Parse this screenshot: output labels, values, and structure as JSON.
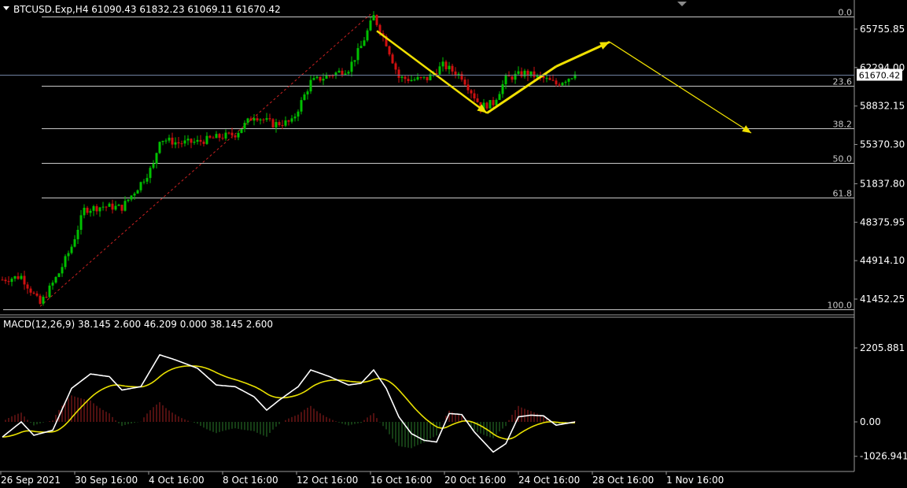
{
  "window": {
    "main_header": "BTCUSD.Exp,H4  61090.43 61832.23 61069.11 61670.42",
    "macd_header": "MACD(12,26,9) 38.145 2.600 46.209 0.000 38.145 2.600"
  },
  "colors": {
    "background": "#000000",
    "bull_candle": "#00c000",
    "bear_candle": "#d01010",
    "fib_line": "#c8c8c8",
    "price_line": "#7080a0",
    "trend_line": "#cc2222",
    "arrow": "#f0e000",
    "macd_line": "#ffffff",
    "signal_line": "#e8e000",
    "hist_pos": "#a02020",
    "hist_neg": "#2a7a2a"
  },
  "chart_data": [
    {
      "type": "candlestick",
      "symbol": "BTCUSD.Exp",
      "timeframe": "H4",
      "ohlc_header": {
        "open": 61090.43,
        "high": 61832.23,
        "low": 61069.11,
        "close": 61670.42
      },
      "y_ticks": [
        "65755.85",
        "62294.00",
        "58832.15",
        "55370.30",
        "51837.80",
        "48375.95",
        "44914.10",
        "41452.25"
      ],
      "ylim": [
        41452.25,
        65755.85
      ],
      "current_price": 61670.42,
      "current_price_label": "61670.42",
      "x_ticks": [
        "26 Sep 2021",
        "30 Sep 16:00",
        "4 Oct 16:00",
        "8 Oct 16:00",
        "12 Oct 16:00",
        "16 Oct 16:00",
        "20 Oct 16:00",
        "24 Oct 16:00",
        "28 Oct 16:00",
        "1 Nov 16:00"
      ],
      "fibonacci": {
        "high": 66900,
        "low": 40550,
        "levels": [
          {
            "ratio": 0.0,
            "label": "0.0"
          },
          {
            "ratio": 0.236,
            "label": "23.6"
          },
          {
            "ratio": 0.382,
            "label": "38.2"
          },
          {
            "ratio": 0.5,
            "label": "50.0"
          },
          {
            "ratio": 0.618,
            "label": "61.8"
          },
          {
            "ratio": 1.0,
            "label": "100.0"
          }
        ]
      },
      "trend_line": [
        {
          "bar": 12,
          "price": 40800
        },
        {
          "bar": 117,
          "price": 67100
        }
      ],
      "arrows": [
        [
          {
            "bar": 119,
            "price": 65600
          },
          {
            "bar": 154,
            "price": 58200
          }
        ],
        [
          {
            "bar": 154,
            "price": 58200
          },
          {
            "bar": 176,
            "price": 62400
          }
        ],
        [
          {
            "bar": 176,
            "price": 62400
          },
          {
            "bar": 193,
            "price": 64600
          }
        ],
        [
          {
            "bar": 193,
            "price": 64600
          },
          {
            "bar": 238,
            "price": 56400
          }
        ]
      ],
      "anchors": [
        [
          0,
          43200
        ],
        [
          6,
          43500
        ],
        [
          12,
          41000
        ],
        [
          18,
          43800
        ],
        [
          22,
          46200
        ],
        [
          26,
          49500
        ],
        [
          32,
          49800
        ],
        [
          38,
          49700
        ],
        [
          43,
          51500
        ],
        [
          48,
          53500
        ],
        [
          50,
          55900
        ],
        [
          56,
          55500
        ],
        [
          62,
          55600
        ],
        [
          68,
          56000
        ],
        [
          74,
          56300
        ],
        [
          80,
          58000
        ],
        [
          86,
          57200
        ],
        [
          92,
          57400
        ],
        [
          98,
          61000
        ],
        [
          104,
          61600
        ],
        [
          110,
          62200
        ],
        [
          114,
          64200
        ],
        [
          118,
          66900
        ],
        [
          122,
          64500
        ],
        [
          126,
          61400
        ],
        [
          130,
          61200
        ],
        [
          135,
          61300
        ],
        [
          140,
          62500
        ],
        [
          146,
          61500
        ],
        [
          152,
          58800
        ],
        [
          156,
          59100
        ],
        [
          160,
          61300
        ],
        [
          166,
          61800
        ],
        [
          172,
          61300
        ],
        [
          176,
          60800
        ],
        [
          182,
          61700
        ]
      ]
    },
    {
      "type": "macd",
      "params": "12,26,9",
      "y_ticks": [
        "2205.881",
        "0.00",
        "-1026.941"
      ],
      "ylim": [
        -1026.941,
        2205.881
      ],
      "macd_anchors": [
        [
          0,
          -450
        ],
        [
          6,
          0
        ],
        [
          10,
          -400
        ],
        [
          16,
          -250
        ],
        [
          22,
          1000
        ],
        [
          28,
          1430
        ],
        [
          34,
          1350
        ],
        [
          38,
          950
        ],
        [
          44,
          1050
        ],
        [
          50,
          2000
        ],
        [
          55,
          1850
        ],
        [
          62,
          1600
        ],
        [
          68,
          1100
        ],
        [
          74,
          1050
        ],
        [
          80,
          750
        ],
        [
          84,
          350
        ],
        [
          88,
          650
        ],
        [
          94,
          1050
        ],
        [
          98,
          1550
        ],
        [
          104,
          1350
        ],
        [
          110,
          1100
        ],
        [
          114,
          1150
        ],
        [
          118,
          1550
        ],
        [
          122,
          1000
        ],
        [
          126,
          150
        ],
        [
          130,
          -350
        ],
        [
          134,
          -550
        ],
        [
          138,
          -600
        ],
        [
          142,
          250
        ],
        [
          146,
          220
        ],
        [
          150,
          -300
        ],
        [
          156,
          -900
        ],
        [
          160,
          -650
        ],
        [
          164,
          150
        ],
        [
          168,
          200
        ],
        [
          172,
          180
        ],
        [
          176,
          -100
        ],
        [
          182,
          0
        ]
      ]
    }
  ]
}
